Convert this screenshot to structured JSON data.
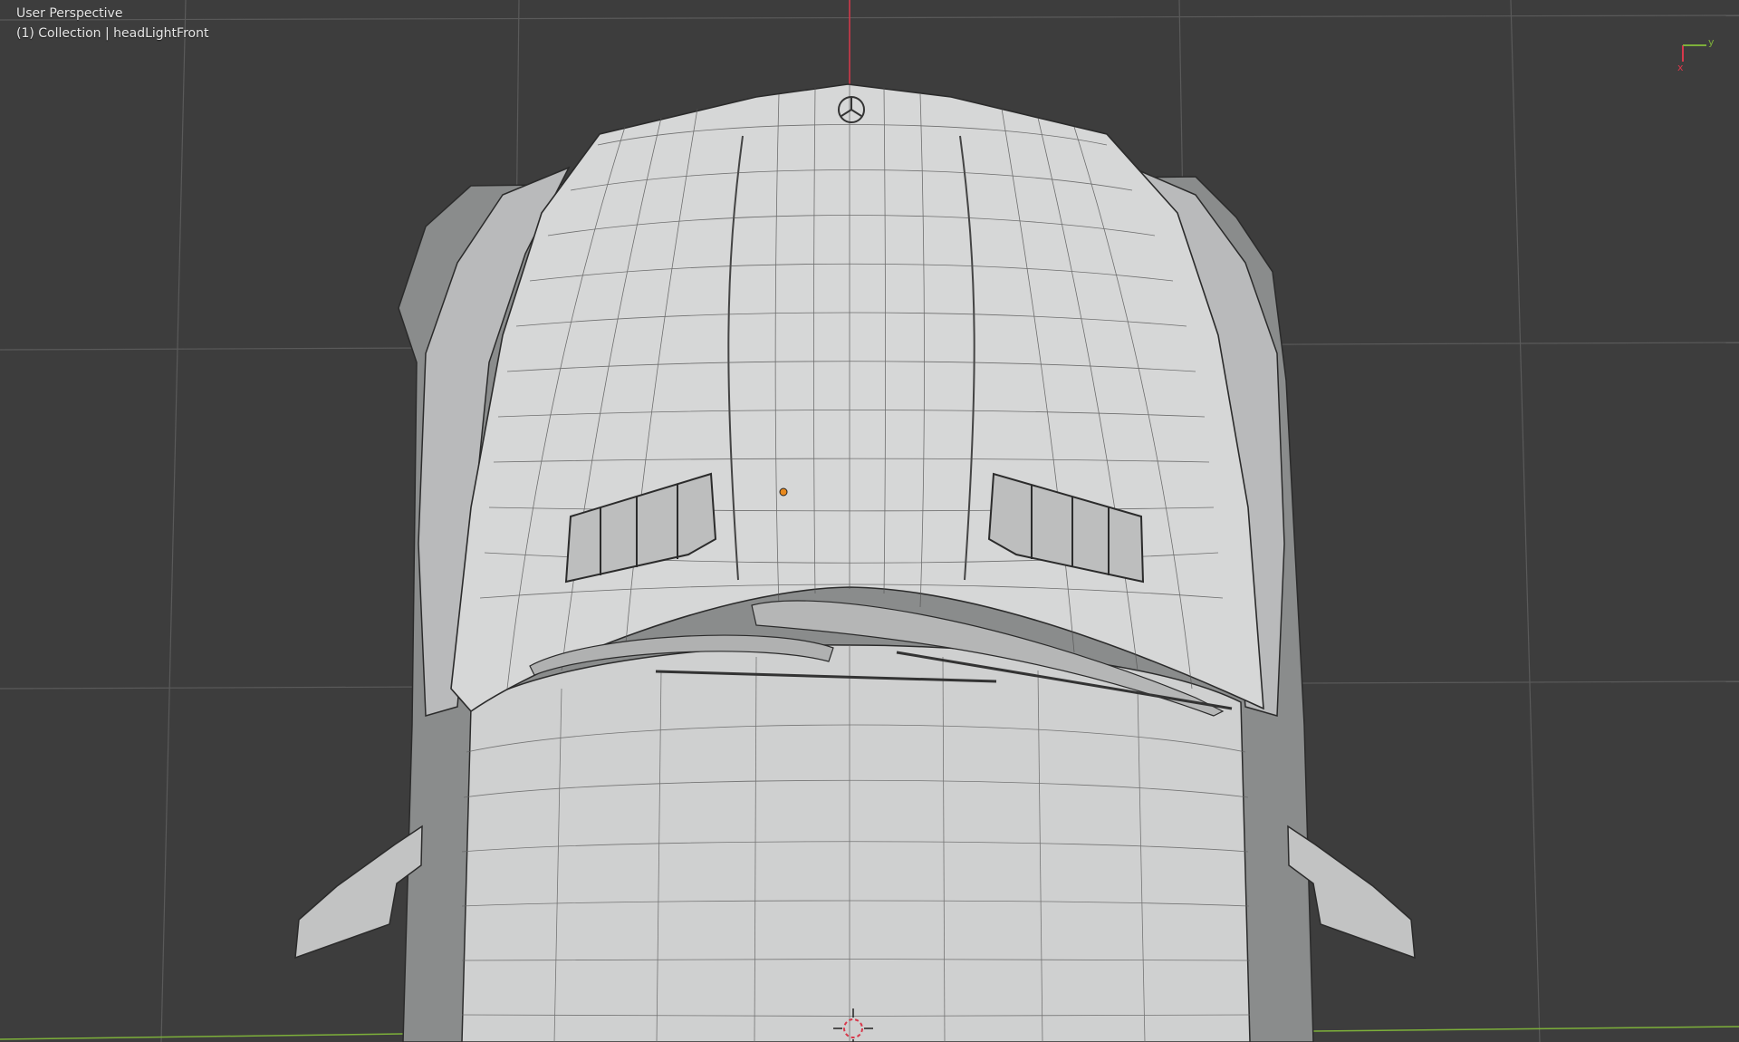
{
  "viewport": {
    "view_name": "User Perspective",
    "collection_info": "(1) Collection | headLightFront",
    "gizmo": {
      "y_label": "y",
      "x_label": "x"
    },
    "colors": {
      "background": "#3d3d3d",
      "grid": "#565656",
      "axis_x": "#d8384b",
      "axis_y": "#7db03a",
      "mesh_fill": "#d2d3d3",
      "wireframe": "#2b2b2b",
      "origin": "#e8891d"
    },
    "object": "headLightFront",
    "cursor_icon": "3d-cursor-icon",
    "origin_icon": "object-origin-icon",
    "emblem_icon": "mercedes-star-icon"
  }
}
